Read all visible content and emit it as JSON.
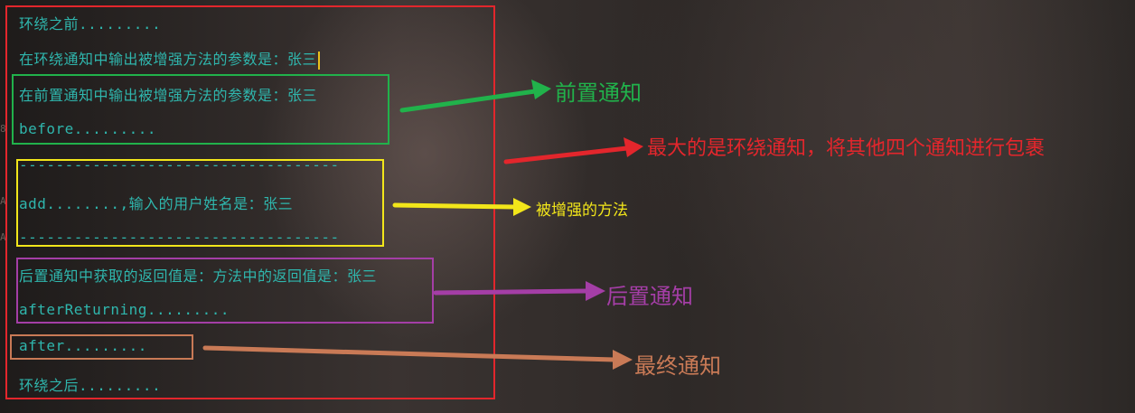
{
  "console": {
    "lines": [
      "环绕之前.........",
      "在环绕通知中输出被增强方法的参数是：张三",
      "在前置通知中输出被增强方法的参数是：张三",
      "before.........",
      "-----------------------------------",
      "add........,输入的用户姓名是：张三",
      "-----------------------------------",
      "后置通知中获取的返回值是：方法中的返回值是：张三",
      "afterReturning.........",
      "after.........",
      "环绕之后........."
    ]
  },
  "labels": {
    "before": "前置通知",
    "around": "最大的是环绕通知，将其他四个通知进行包裹",
    "target": "被增强的方法",
    "after_returning": "后置通知",
    "after": "最终通知"
  },
  "colors": {
    "console_text": "#2fb6ad",
    "around": "#e3262c",
    "before": "#21b24b",
    "target": "#f2e61a",
    "after_returning": "#a43ea6",
    "after": "#c97a56"
  }
}
